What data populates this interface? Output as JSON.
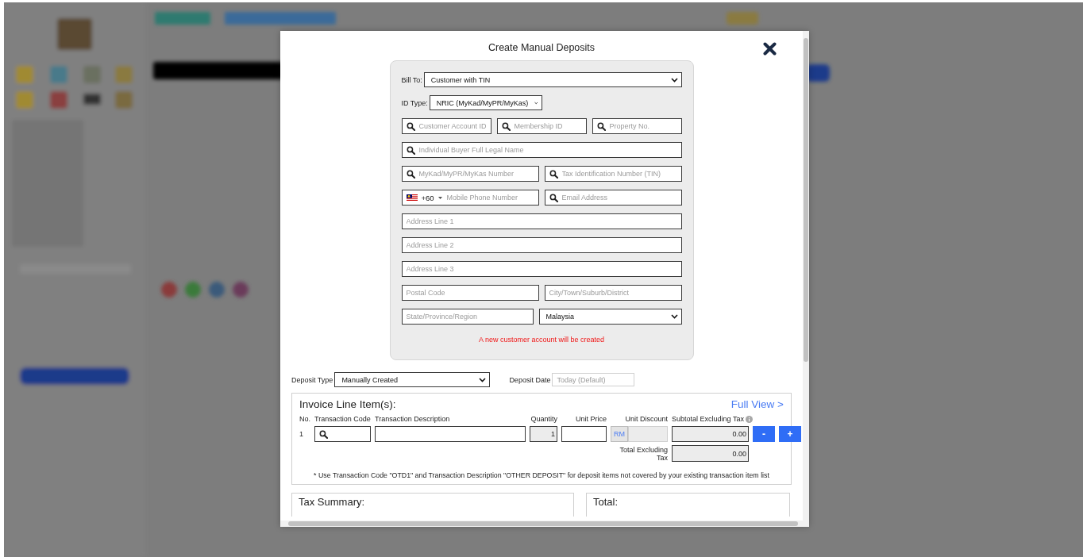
{
  "dialog": {
    "title": "Create Manual Deposits"
  },
  "customer": {
    "bill_to": {
      "label": "Bill To:",
      "value": "Customer with TIN"
    },
    "id_type": {
      "label": "ID Type:",
      "value": "NRIC (MyKad/MyPR/MyKas)"
    },
    "rows": [
      [
        {
          "kind": "search",
          "placeholder": "Customer Account ID"
        },
        {
          "kind": "search",
          "placeholder": "Membership ID"
        },
        {
          "kind": "search",
          "placeholder": "Property No."
        }
      ],
      [
        {
          "kind": "search",
          "placeholder": "Individual Buyer Full Legal Name"
        }
      ],
      [
        {
          "kind": "search",
          "placeholder": "MyKad/MyPR/MyKas Number"
        },
        {
          "kind": "search",
          "placeholder": "Tax Identification Number (TIN)"
        }
      ],
      [
        {
          "kind": "phone",
          "code": "+60",
          "placeholder": "Mobile Phone Number"
        },
        {
          "kind": "search",
          "placeholder": "Email Address"
        }
      ],
      [
        {
          "kind": "text",
          "placeholder": "Address Line 1"
        }
      ],
      [
        {
          "kind": "text",
          "placeholder": "Address Line 2"
        }
      ],
      [
        {
          "kind": "text",
          "placeholder": "Address Line 3"
        }
      ],
      [
        {
          "kind": "text",
          "placeholder": "Postal Code"
        },
        {
          "kind": "text",
          "placeholder": "City/Town/Suburb/District"
        }
      ],
      [
        {
          "kind": "text",
          "placeholder": "State/Province/Region"
        },
        {
          "kind": "select",
          "value": "Malaysia"
        }
      ]
    ],
    "notice": "A new customer account will be created"
  },
  "deposit_type": {
    "label": "Deposit Type",
    "value": "Manually Created"
  },
  "deposit_date": {
    "label": "Deposit Date",
    "placeholder": "Today (Default)"
  },
  "invoice": {
    "title": "Invoice Line Item(s):",
    "full_view": "Full View >",
    "columns": [
      "No.",
      "Transaction Code",
      "Transaction Description",
      "Quantity",
      "Unit Price",
      "Unit Discount",
      "Subtotal Excluding Tax"
    ],
    "rows": [
      {
        "no": "1",
        "quantity": "1",
        "currency": "RM",
        "subtotal": "0.00"
      }
    ],
    "buttons": [
      "-",
      "+"
    ],
    "total_label": "Total Excluding Tax",
    "total": "0.00",
    "note": "* Use Transaction Code \"OTD1\" and Transaction Description \"OTHER DEPOSIT\" for deposit items not covered by your existing transaction item list"
  },
  "summary_cards": [
    "Tax Summary:",
    "Total:"
  ]
}
